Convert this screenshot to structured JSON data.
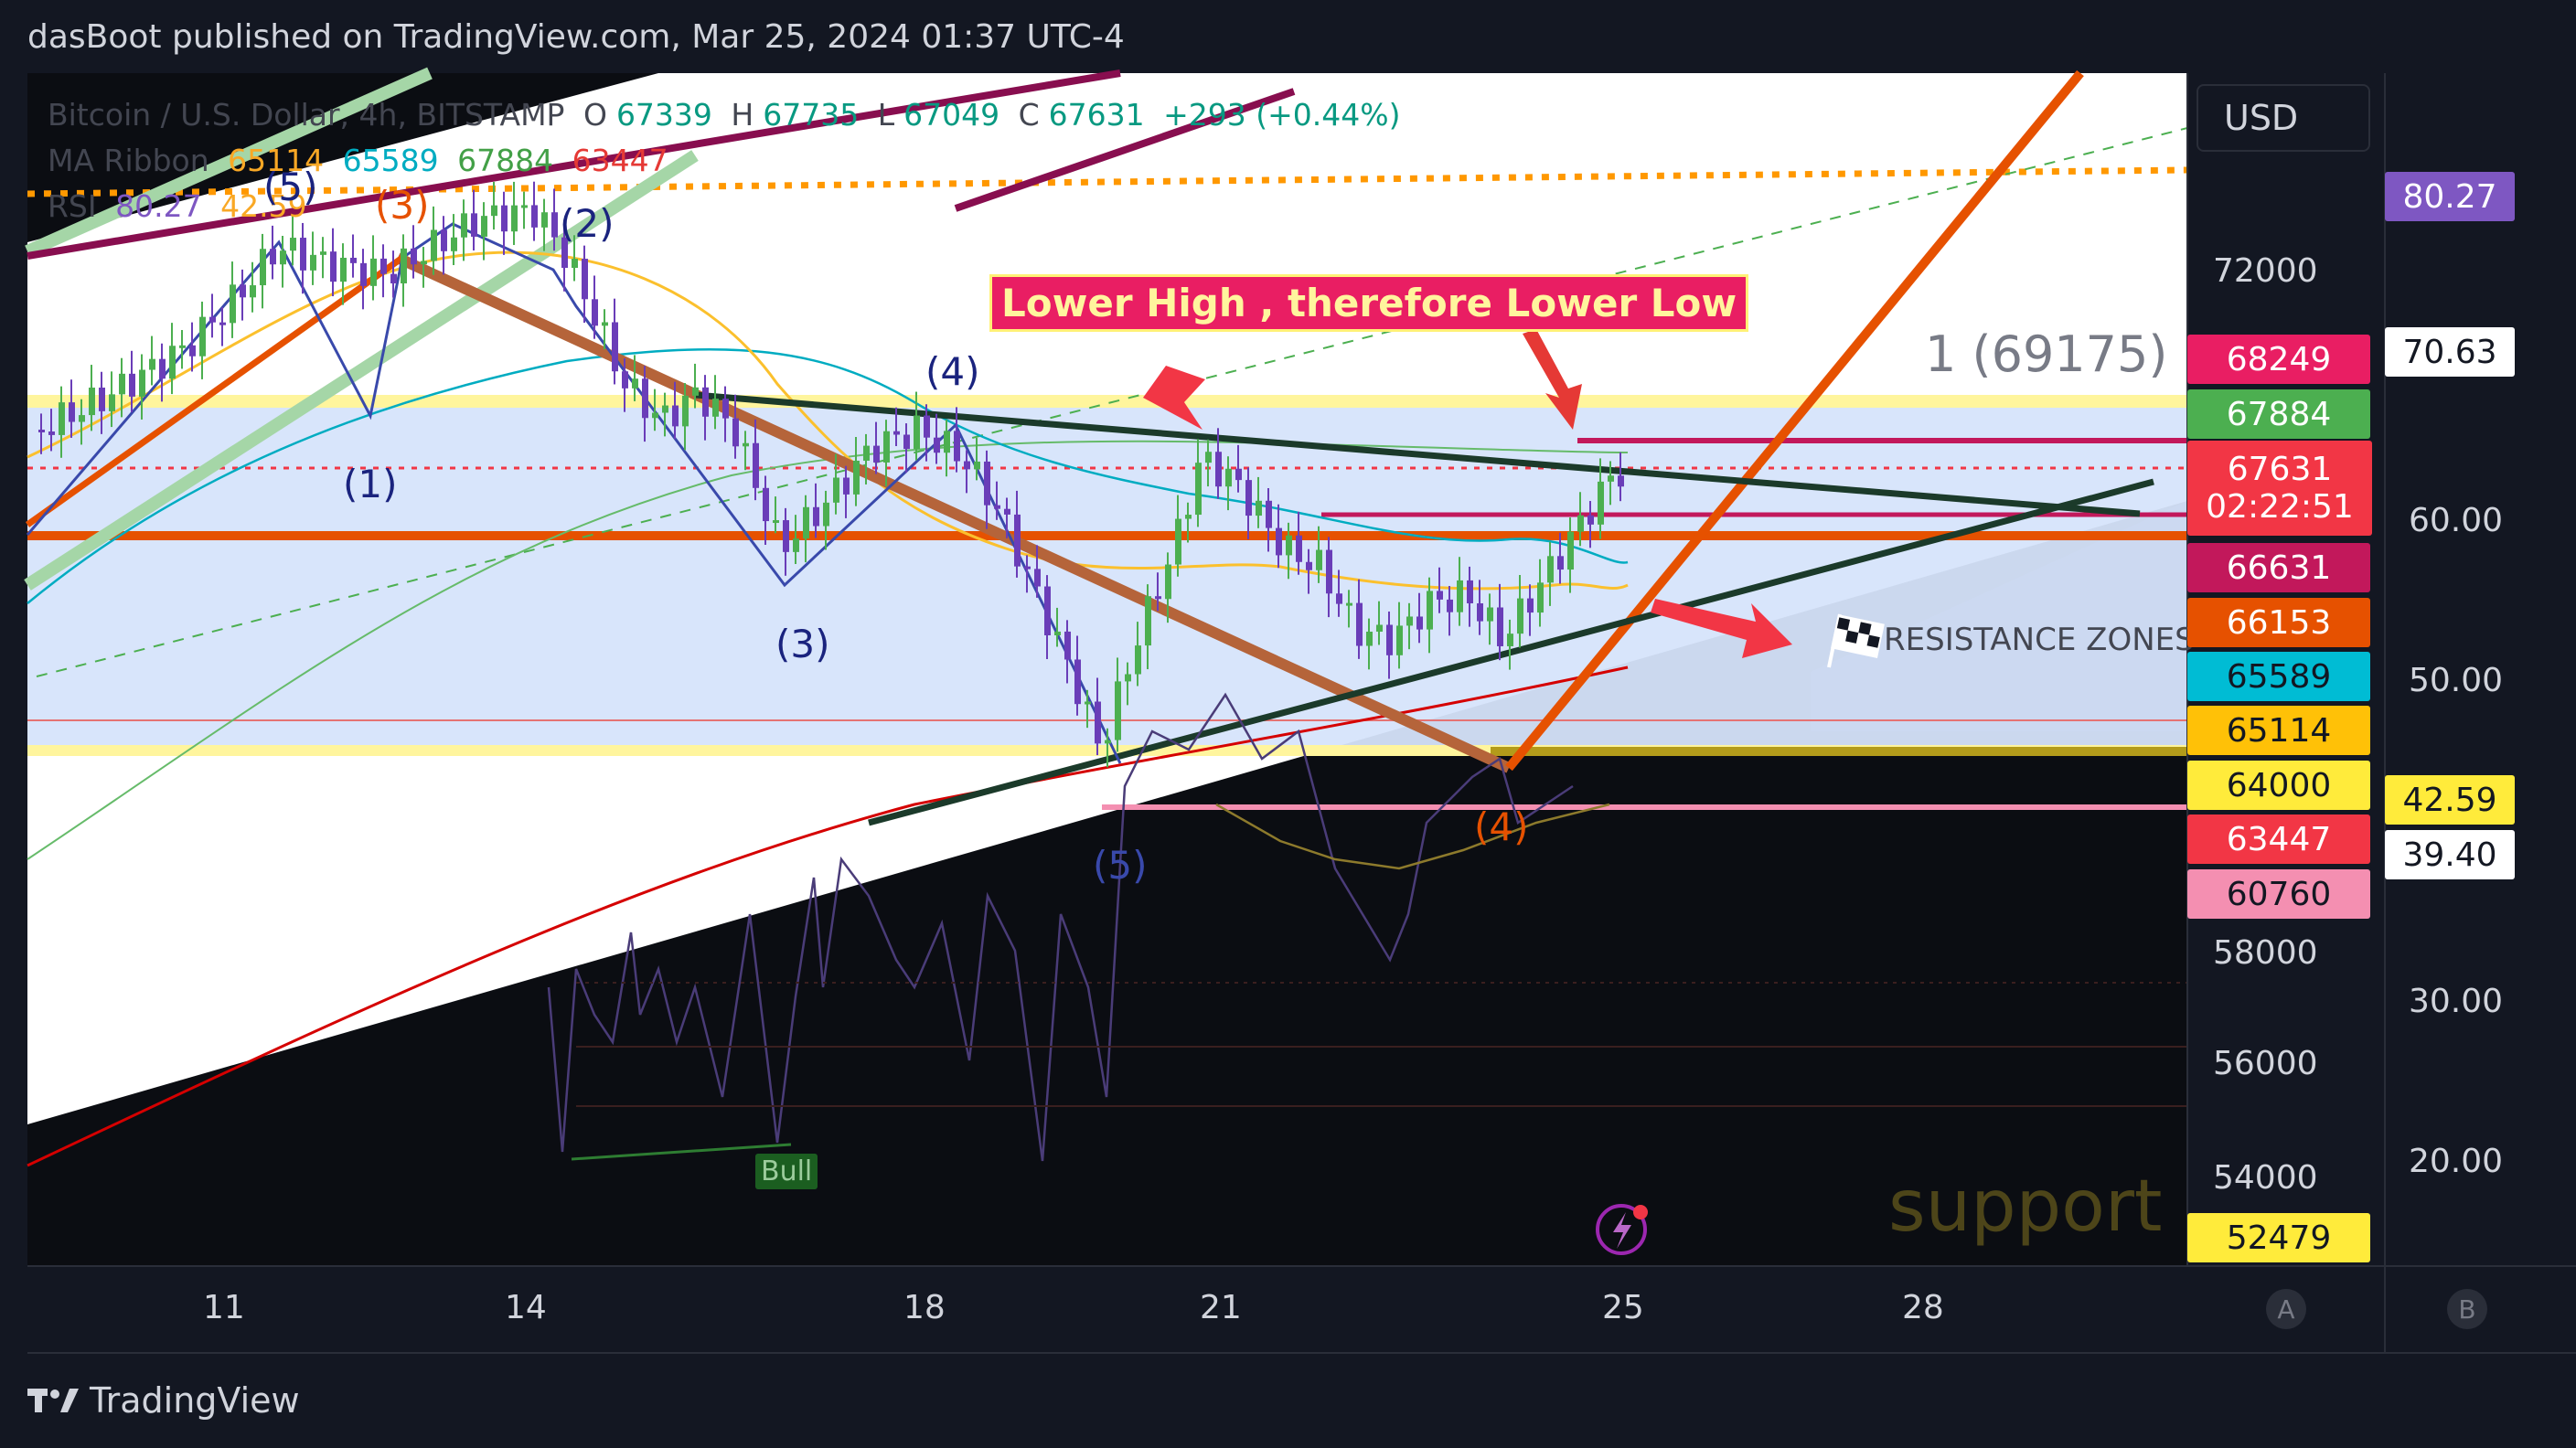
{
  "header": {
    "publisher_text": "dasBoot published on TradingView.com, Mar 25, 2024 01:37 UTC-4"
  },
  "legend": {
    "symbol": "Bitcoin / U.S. Dollar, 4h, BITSTAMP",
    "o_label": "O",
    "o_value": "67339",
    "h_label": "H",
    "h_value": "67735",
    "l_label": "L",
    "l_value": "67049",
    "c_label": "C",
    "c_value": "67631",
    "change": "+293 (+0.44%)",
    "ma_ribbon_label": "MA Ribbon",
    "ma_values": [
      "65114",
      "65589",
      "67884",
      "63447"
    ],
    "rsi_label": "RSI",
    "rsi_values": [
      "80.27",
      "42.59"
    ]
  },
  "currency_button": "USD",
  "price_axis_labels": [
    "72000",
    "58000",
    "56000",
    "54000"
  ],
  "price_tags": [
    {
      "label": "68249",
      "color": "#e91e63"
    },
    {
      "label": "67884",
      "color": "#4caf50"
    },
    {
      "label": "67631",
      "sub": "02:22:51",
      "color": "#f23645"
    },
    {
      "label": "66631",
      "color": "#e91e63"
    },
    {
      "label": "66153",
      "color": "#e65100"
    },
    {
      "label": "65589",
      "color": "#00bcd4"
    },
    {
      "label": "65114",
      "color": "#ffc107"
    },
    {
      "label": "64000",
      "color": "#ffeb3b"
    },
    {
      "label": "63447",
      "color": "#f23645"
    },
    {
      "label": "60760",
      "color": "#f48fb1"
    },
    {
      "label": "52479",
      "color": "#ffeb3b"
    }
  ],
  "rsi_axis_labels": [
    "60.00",
    "50.00",
    "30.00",
    "20.00"
  ],
  "rsi_tags": [
    {
      "label": "80.27",
      "color": "#7e57c2",
      "text": "#ffffff"
    },
    {
      "label": "70.63",
      "color": "#ffffff",
      "text": "#131722"
    },
    {
      "label": "42.59",
      "color": "#ffeb3b",
      "text": "#131722"
    },
    {
      "label": "39.40",
      "color": "#ffffff",
      "text": "#131722"
    }
  ],
  "time_axis": [
    "11",
    "14",
    "18",
    "21",
    "25",
    "28"
  ],
  "annotations": {
    "lower_high": "Lower High , therefore Lower Low",
    "fib_level": "1 (69175)",
    "resistance_zones": "RESISTANCE ZONES",
    "support": "support",
    "bull": "Bull",
    "wave_labels": [
      "(5)",
      "(3)",
      "(2)",
      "(1)",
      "(4)",
      "(3)",
      "(5)",
      "(4)"
    ]
  },
  "scale_buttons": [
    "A",
    "B"
  ],
  "brand": "TradingView",
  "colors": {
    "background": "#131722",
    "panel_bg": "#ffffff",
    "zone_fill": "#d6e4fb",
    "bull_candle": "#4caf50",
    "bear_candle": "#6a3db8",
    "accent_orange": "#e65100",
    "annotation_box": "#e91e63"
  }
}
